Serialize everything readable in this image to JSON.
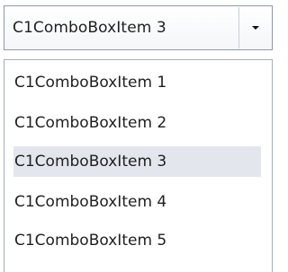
{
  "combo": {
    "selected_text": "C1ComboBoxItem 3",
    "icon": "chevron-down-icon"
  },
  "dropdown": {
    "items": [
      {
        "label": "C1ComboBoxItem 1",
        "selected": false
      },
      {
        "label": "C1ComboBoxItem 2",
        "selected": false
      },
      {
        "label": "C1ComboBoxItem 3",
        "selected": true
      },
      {
        "label": "C1ComboBoxItem 4",
        "selected": false
      },
      {
        "label": "C1ComboBoxItem 5",
        "selected": false
      }
    ]
  },
  "colors": {
    "selected_background": "#e3e6ec",
    "border": "#8e9aa8",
    "text": "#1f1f1f"
  }
}
